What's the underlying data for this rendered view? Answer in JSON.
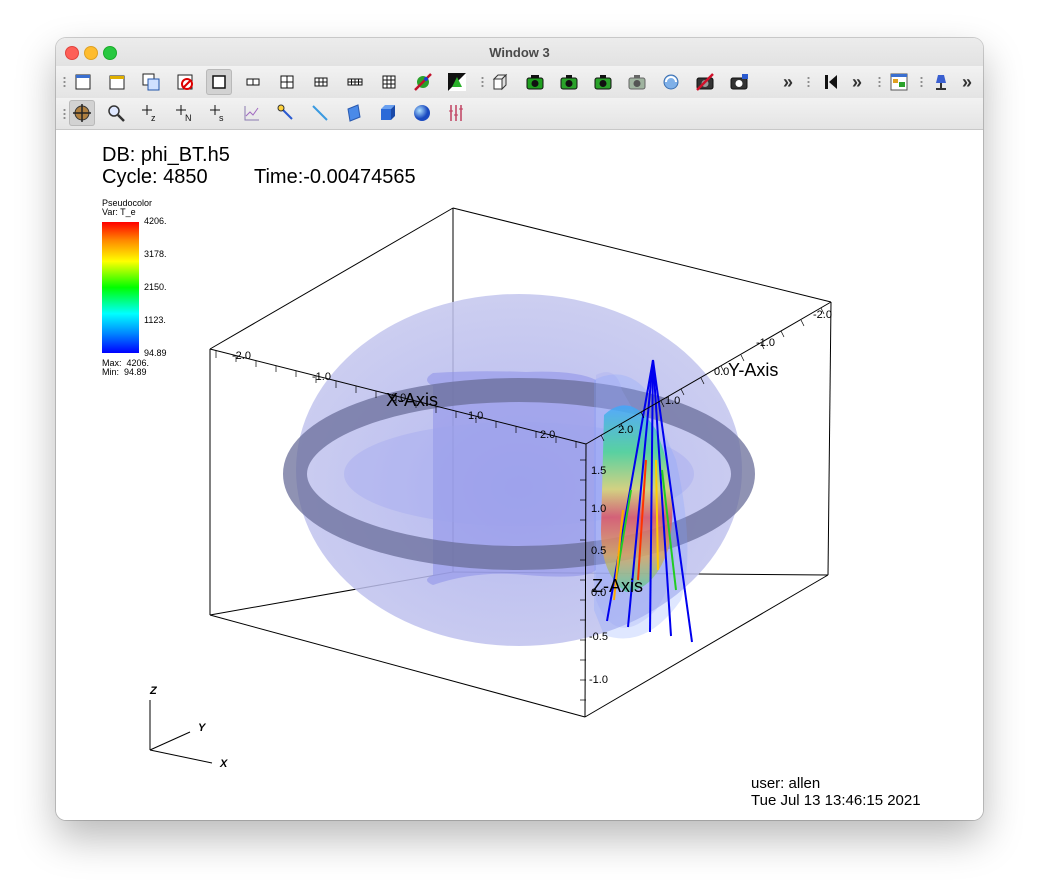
{
  "window": {
    "title": "Window 3"
  },
  "toolbar1": {
    "items": [
      {
        "name": "new-window-icon",
        "pressed": false
      },
      {
        "name": "clear-window-icon",
        "pressed": false
      },
      {
        "name": "clone-window-icon",
        "pressed": false
      },
      {
        "name": "delete-window-icon",
        "pressed": false
      },
      {
        "name": "layout-1x1-icon",
        "pressed": true
      },
      {
        "name": "layout-1x2-icon",
        "pressed": false
      },
      {
        "name": "layout-2x2-icon",
        "pressed": false
      },
      {
        "name": "layout-2x3-icon",
        "pressed": false
      },
      {
        "name": "layout-2x4-icon",
        "pressed": false
      },
      {
        "name": "layout-3x3-icon",
        "pressed": false
      },
      {
        "name": "spin-lock-icon",
        "pressed": false
      },
      {
        "name": "invert-background-icon",
        "pressed": false
      },
      {
        "name": "reset-view-icon",
        "pressed": false
      },
      {
        "name": "camera-lock-icon",
        "pressed": false
      },
      {
        "name": "camera-icon",
        "pressed": false
      },
      {
        "name": "camera-save-icon",
        "pressed": false
      },
      {
        "name": "camera-restore-icon",
        "pressed": false
      },
      {
        "name": "camera-rotate-icon",
        "pressed": false
      },
      {
        "name": "camera-clear-icon",
        "pressed": false
      },
      {
        "name": "camera-snapshot-icon",
        "pressed": false
      }
    ]
  },
  "toolbar2": {
    "items": [
      {
        "name": "navigate-mode-icon",
        "pressed": true
      },
      {
        "name": "zoom-mode-icon",
        "pressed": false
      },
      {
        "name": "zone-pick-icon",
        "label": "z",
        "pressed": false
      },
      {
        "name": "node-pick-icon",
        "label": "N",
        "pressed": false
      },
      {
        "name": "spreadsheet-pick-icon",
        "label": "s",
        "pressed": false
      },
      {
        "name": "curve-pick-icon",
        "pressed": false
      },
      {
        "name": "point-tool-icon",
        "pressed": false
      },
      {
        "name": "line-tool-icon",
        "pressed": false
      },
      {
        "name": "plane-tool-icon",
        "pressed": false
      },
      {
        "name": "box-tool-icon",
        "pressed": false
      },
      {
        "name": "sphere-tool-icon",
        "pressed": false
      },
      {
        "name": "axis-restriction-icon",
        "pressed": false
      }
    ]
  },
  "annotation": {
    "db": "DB: phi_BT.h5",
    "cycle": "Cycle: 4850",
    "time": "Time:-0.00474565",
    "user": "user: allen",
    "date": "Tue Jul 13 13:46:15 2021"
  },
  "legend": {
    "plot": "Pseudocolor",
    "var": "Var: T_e",
    "ticks": [
      "4206.",
      "3178.",
      "2150.",
      "1123.",
      "94.89"
    ],
    "max": "Max:  4206.",
    "min": "Min:  94.89",
    "colors": [
      "#ff0000",
      "#ff8800",
      "#ffff00",
      "#00ff00",
      "#00ffff",
      "#0088ff",
      "#0000ff"
    ]
  },
  "axes": {
    "x_title": "X-Axis",
    "y_title": "Y-Axis",
    "z_title": "Z-Axis",
    "x_ticks": [
      "-2.0",
      "-1.0",
      "0.0",
      "1.0",
      "2.0"
    ],
    "y_ticks": [
      "-2.0",
      "-1.0",
      "0.0",
      "1.0",
      "2.0"
    ],
    "z_ticks": [
      "1.5",
      "1.0",
      "0.5",
      "0.0",
      "-0.5",
      "-1.0"
    ],
    "triad": {
      "x": "X",
      "y": "Y",
      "z": "Z"
    }
  },
  "colors": {
    "torus_fill": "#b8bbee",
    "torus_band": "#6a6e9a",
    "titlebar": "#e6e6e6"
  }
}
